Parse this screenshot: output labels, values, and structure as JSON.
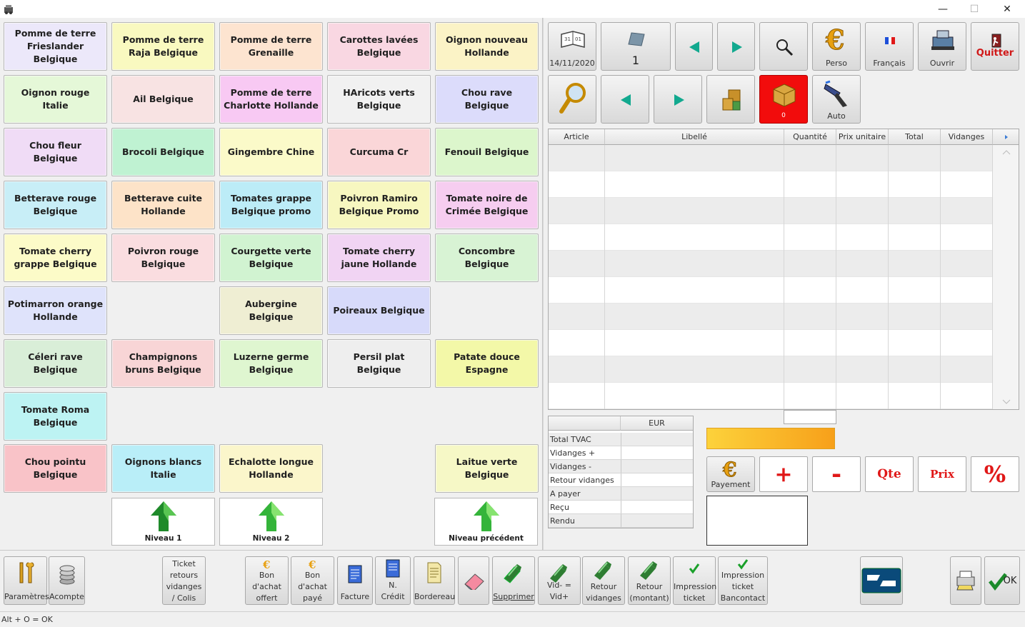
{
  "window": {
    "minimize": "—",
    "maximize": "☐",
    "close": "✕"
  },
  "products": [
    {
      "label": "Pomme de terre Frieslander Belgique",
      "color": "#ece8fa"
    },
    {
      "label": "Pomme de terre Raja Belgique",
      "color": "#f9f9c0"
    },
    {
      "label": "Pomme de terre Grenaille",
      "color": "#fde4d0"
    },
    {
      "label": "Carottes lavées Belgique",
      "color": "#f9d7e2"
    },
    {
      "label": "Oignon nouveau Hollande",
      "color": "#fbf3c6"
    },
    {
      "label": "Oignon rouge Italie",
      "color": "#e5f8d8"
    },
    {
      "label": "Ail Belgique",
      "color": "#f8e3e3"
    },
    {
      "label": "Pomme de terre Charlotte Hollande",
      "color": "#f8c9f3"
    },
    {
      "label": "HAricots verts Belgique",
      "color": "#f1f1f1"
    },
    {
      "label": "Chou rave Belgique",
      "color": "#dcdcfb"
    },
    {
      "label": "Chou fleur Belgique",
      "color": "#f0dcf6"
    },
    {
      "label": "Brocoli Belgique",
      "color": "#bff2d2"
    },
    {
      "label": "Gingembre Chine",
      "color": "#fbfac9"
    },
    {
      "label": "Curcuma Cr",
      "color": "#fad6d8"
    },
    {
      "label": "Fenouil Belgique",
      "color": "#dcf6cc"
    },
    {
      "label": "Betterave rouge Belgique",
      "color": "#c8eef7"
    },
    {
      "label": "Betterave cuite Hollande",
      "color": "#fde3c8"
    },
    {
      "label": "Tomates grappe Belgique promo",
      "color": "#bcecf7"
    },
    {
      "label": "Poivron Ramiro Belgique Promo",
      "color": "#f7f7c0"
    },
    {
      "label": "Tomate noire de Crimée Belgique",
      "color": "#f6cdf0"
    },
    {
      "label": "Tomate cherry grappe Belgique",
      "color": "#fcfbc8"
    },
    {
      "label": "Poivron rouge Belgique",
      "color": "#fadde0"
    },
    {
      "label": "Courgette verte Belgique",
      "color": "#d1f3d1"
    },
    {
      "label": "Tomate cherry jaune Hollande",
      "color": "#f1d4f3"
    },
    {
      "label": "Concombre Belgique",
      "color": "#d8f3d4"
    },
    {
      "label": "Potimarron orange Hollande",
      "color": "#dfe3fb"
    },
    {
      "label": "",
      "color": ""
    },
    {
      "label": "Aubergine Belgique",
      "color": "#efeed3"
    },
    {
      "label": "Poireaux Belgique",
      "color": "#d7dafa"
    },
    {
      "label": "",
      "color": ""
    },
    {
      "label": "Céleri rave Belgique",
      "color": "#d9eed8"
    },
    {
      "label": "Champignons bruns Belgique",
      "color": "#f8d5d6"
    },
    {
      "label": "Luzerne germe Belgique",
      "color": "#dff6d0"
    },
    {
      "label": "Persil plat Belgique",
      "color": "#eeeeee"
    },
    {
      "label": "Patate douce Espagne",
      "color": "#f3f8a8"
    },
    {
      "label": "Tomate Roma Belgique",
      "color": "#bdf3f3"
    },
    {
      "label": "",
      "color": ""
    },
    {
      "label": "",
      "color": ""
    },
    {
      "label": "",
      "color": ""
    },
    {
      "label": "",
      "color": ""
    },
    {
      "label": "Chou pointu Belgique",
      "color": "#f9c3c8"
    },
    {
      "label": "Oignons blancs Italie",
      "color": "#b9eef8"
    },
    {
      "label": "Echalotte longue Hollande",
      "color": "#fbf6cb"
    },
    {
      "label": "",
      "color": ""
    },
    {
      "label": "Laitue verte Belgique",
      "color": "#f6f8c6"
    }
  ],
  "levels": {
    "n1": "Niveau 1",
    "n2": "Niveau 2",
    "prev": "Niveau précédent"
  },
  "toolbar": {
    "date": "14/11/2020",
    "ticket_number": "1",
    "perso": "Perso",
    "language": "Français",
    "ouvrir": "Ouvrir",
    "quitter": "Quitter",
    "box_count": "0",
    "auto": "Auto"
  },
  "grid": {
    "columns": [
      "Article",
      "Libellé",
      "Quantité",
      "Prix unitaire",
      "Total",
      "Vidanges"
    ]
  },
  "totals": {
    "currency": "EUR",
    "rows": [
      "Total TVAC",
      "Vidanges +",
      "Vidanges -",
      "Retour vidanges",
      "A payer",
      "Reçu",
      "Rendu"
    ]
  },
  "operations": {
    "payement": "Payement",
    "plus": "+",
    "minus": "-",
    "qte": "Qte",
    "prix": "Prix",
    "percent": "%"
  },
  "bottom": {
    "parametres": "Paramètres",
    "acompte": "Acompte",
    "ticket_retours": "Ticket retours vidanges / Colis",
    "bon_offert": "Bon d'achat offert",
    "bon_paye": "Bon d'achat payé",
    "facture": "Facture",
    "n_credit": "N. Crédit",
    "bordereau": "Bordereau",
    "supprimer": "Supprimer",
    "vid": "Vid- = Vid+",
    "retour_vidanges": "Retour vidanges",
    "retour_montant": "Retour (montant)",
    "impression_ticket": "Impression ticket",
    "impression_bancontact": "Impression ticket Bancontact",
    "ok": "OK"
  },
  "status": "Alt + O = OK"
}
